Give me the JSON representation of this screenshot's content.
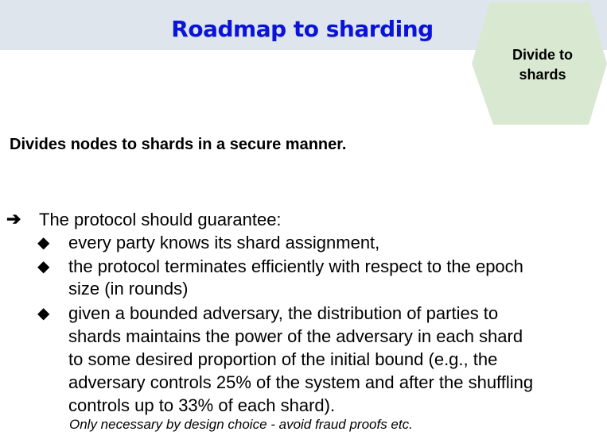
{
  "header": {
    "title": "Roadmap to sharding"
  },
  "badge": {
    "line1": "Divide to",
    "line2": "shards",
    "color": "#d9e8d0"
  },
  "subtitle": "Divides nodes to shards in a secure manner.",
  "main": {
    "lead": "The protocol should guarantee:",
    "bullets": [
      {
        "lines": [
          "every party knows its shard assignment,"
        ]
      },
      {
        "lines": [
          "the protocol terminates efficiently with respect to the epoch",
          "size (in rounds)"
        ]
      },
      {
        "lines": [
          "given a bounded adversary, the distribution of parties to",
          "shards maintains the power of the adversary in each shard",
          "to some desired proportion of the initial bound (e.g., the",
          "adversary controls 25% of the system and after the shuffling",
          "controls up to 33% of each shard)."
        ]
      }
    ],
    "note": "Only necessary by design choice - avoid fraud proofs etc."
  }
}
